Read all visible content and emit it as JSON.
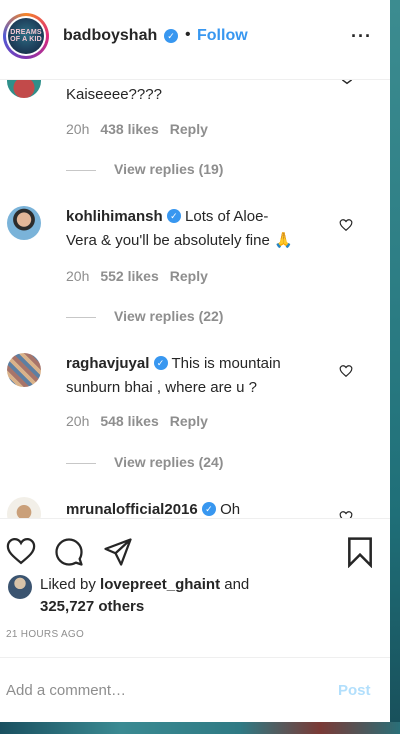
{
  "header": {
    "username": "badboyshah",
    "separator": "•",
    "follow_label": "Follow",
    "more_label": "···",
    "avatar_text": "DREAMS OF A KID"
  },
  "comments": [
    {
      "user": "",
      "text": "Kaiseeee????",
      "time": "20h",
      "likes": "438 likes",
      "reply": "Reply",
      "view_replies": "View replies (19)"
    },
    {
      "user": "kohlihimansh",
      "verified": true,
      "text": "Lots of Aloe-Vera & you'll be absolutely fine 🙏",
      "line1": "Lots of Aloe-",
      "line2": "Vera & you'll be absolutely fine 🙏",
      "time": "20h",
      "likes": "552 likes",
      "reply": "Reply",
      "view_replies": "View replies (22)"
    },
    {
      "user": "raghavjuyal",
      "verified": true,
      "line1": "This is mountain",
      "line2": "sunburn bhai , where are u ?",
      "time": "20h",
      "likes": "548 likes",
      "reply": "Reply",
      "view_replies": "View replies (24)"
    },
    {
      "user": "mrunalofficial2016",
      "verified": true,
      "line1": "Oh"
    }
  ],
  "likes_summary": {
    "prefix": "Liked by ",
    "liker": "lovepreet_ghaint",
    "mid": " and",
    "count": "325,727 others"
  },
  "timestamp": "21 HOURS AGO",
  "comment_box": {
    "placeholder": "Add a comment…",
    "post_label": "Post"
  },
  "colors": {
    "accent": "#3897f0",
    "muted": "#8e8e8e",
    "post_disabled": "#b2dffc"
  },
  "icons": [
    "heart-icon",
    "comment-icon",
    "share-icon",
    "bookmark-icon",
    "more-icon",
    "verified-icon"
  ]
}
